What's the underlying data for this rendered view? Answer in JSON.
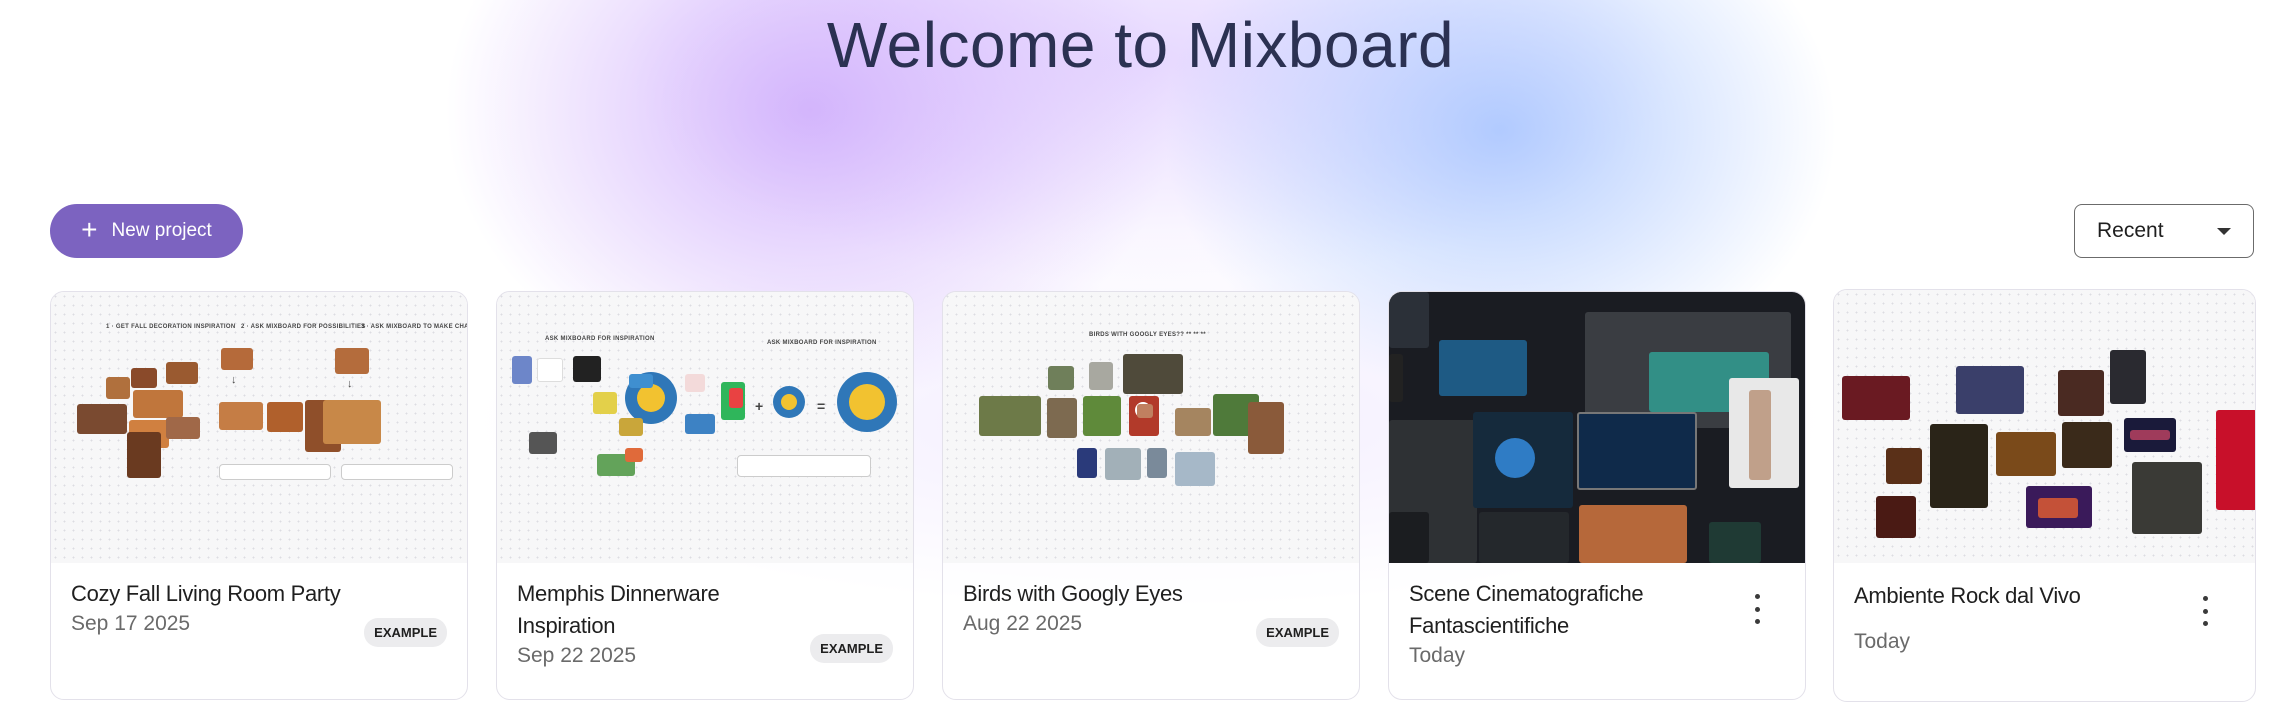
{
  "title": "Welcome to Mixboard",
  "new_project": {
    "label": "New project",
    "icon": "plus-icon"
  },
  "sort": {
    "selected": "Recent"
  },
  "projects": [
    {
      "name": "Cozy Fall Living Room Party",
      "date": "Sep 17 2025",
      "badge": "EXAMPLE"
    },
    {
      "name": "Memphis Dinnerware Inspiration",
      "date": "Sep 22 2025",
      "badge": "EXAMPLE"
    },
    {
      "name": "Birds with Googly Eyes",
      "date": "Aug 22 2025",
      "badge": "EXAMPLE"
    },
    {
      "name": "Scene Cinematografiche Fantascientifiche",
      "date": "Today"
    },
    {
      "name": "Ambiente Rock dal Vivo",
      "date": "Today"
    }
  ]
}
